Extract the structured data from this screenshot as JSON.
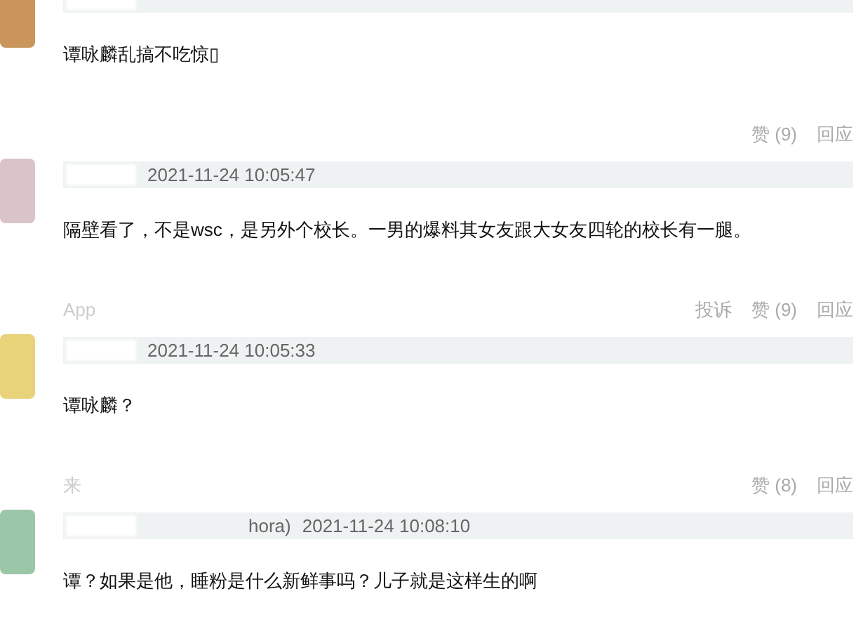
{
  "comments": [
    {
      "text": "谭咏麟乱搞不吃惊▯",
      "actions": [
        {
          "label": "赞 (9)"
        },
        {
          "label": "回应"
        }
      ]
    },
    {
      "time": "2021-11-24 10:05:47",
      "text": "隔壁看了，不是wsc，是另外个校长。一男的爆料其女友跟大女友四轮的校长有一腿。",
      "source": "App",
      "actions": [
        {
          "label": "投诉"
        },
        {
          "label": "赞 (9)"
        },
        {
          "label": "回应"
        }
      ]
    },
    {
      "time": "2021-11-24 10:05:33",
      "text": "谭咏麟？",
      "source": "来",
      "actions": [
        {
          "label": "赞 (8)"
        },
        {
          "label": "回应"
        }
      ]
    },
    {
      "user_tail": "hora)",
      "time": "2021-11-24 10:08:10",
      "text": "谭？如果是他，睡粉是什么新鲜事吗？儿子就是这样生的啊"
    }
  ]
}
